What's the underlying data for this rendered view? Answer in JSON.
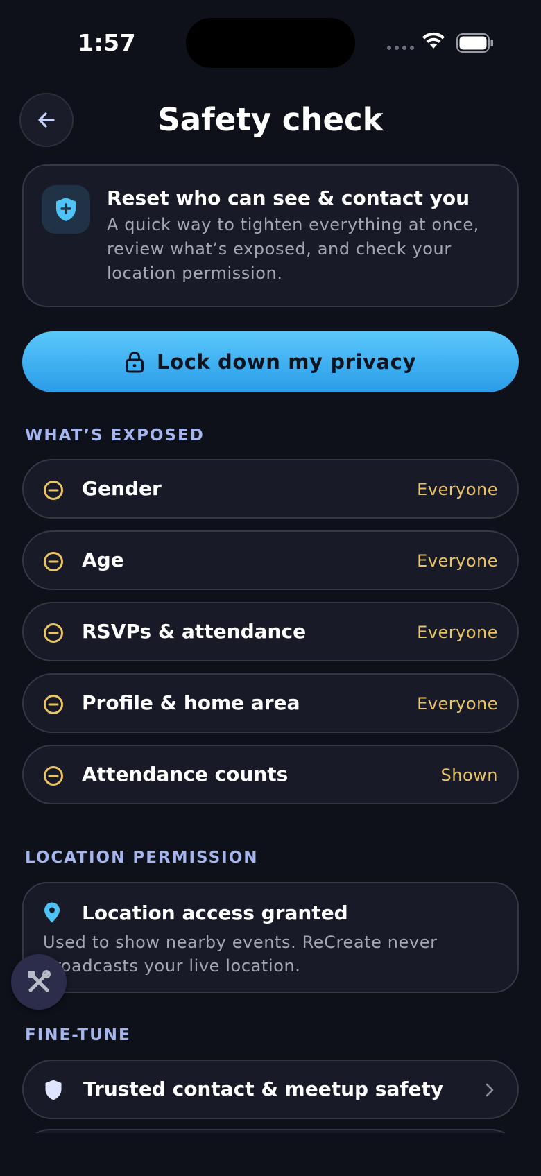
{
  "status_bar": {
    "time": "1:57"
  },
  "header": {
    "title": "Safety check"
  },
  "intro": {
    "title": "Reset who can see & contact you",
    "description": "A quick way to tighten everything at once, review what’s exposed, and check your location permission."
  },
  "lock_button": {
    "label": "Lock down my privacy"
  },
  "exposed": {
    "section_label": "WHAT’S EXPOSED",
    "items": [
      {
        "label": "Gender",
        "value": "Everyone"
      },
      {
        "label": "Age",
        "value": "Everyone"
      },
      {
        "label": "RSVPs & attendance",
        "value": "Everyone"
      },
      {
        "label": "Profile & home area",
        "value": "Everyone"
      },
      {
        "label": "Attendance counts",
        "value": "Shown"
      }
    ]
  },
  "location": {
    "section_label": "LOCATION PERMISSION",
    "title": "Location access granted",
    "description": "Used to show nearby events. ReCreate never broadcasts your live location."
  },
  "fine_tune": {
    "section_label": "FINE-TUNE",
    "items": [
      {
        "label": "Trusted contact & meetup safety"
      }
    ]
  },
  "icons": {
    "back": "arrow-left-icon",
    "intro": "shield-plus-icon",
    "lock": "lock-icon",
    "exposed_item": "minus-circle-icon",
    "location": "map-pin-icon",
    "fab": "tools-icon",
    "trusted": "shield-icon",
    "chevron": "chevron-right-icon"
  },
  "colors": {
    "background": "#0f111a",
    "card": "#181b27",
    "accent": "#4fc3f7",
    "warning": "#eac463",
    "section_label": "#a5b6ef"
  }
}
